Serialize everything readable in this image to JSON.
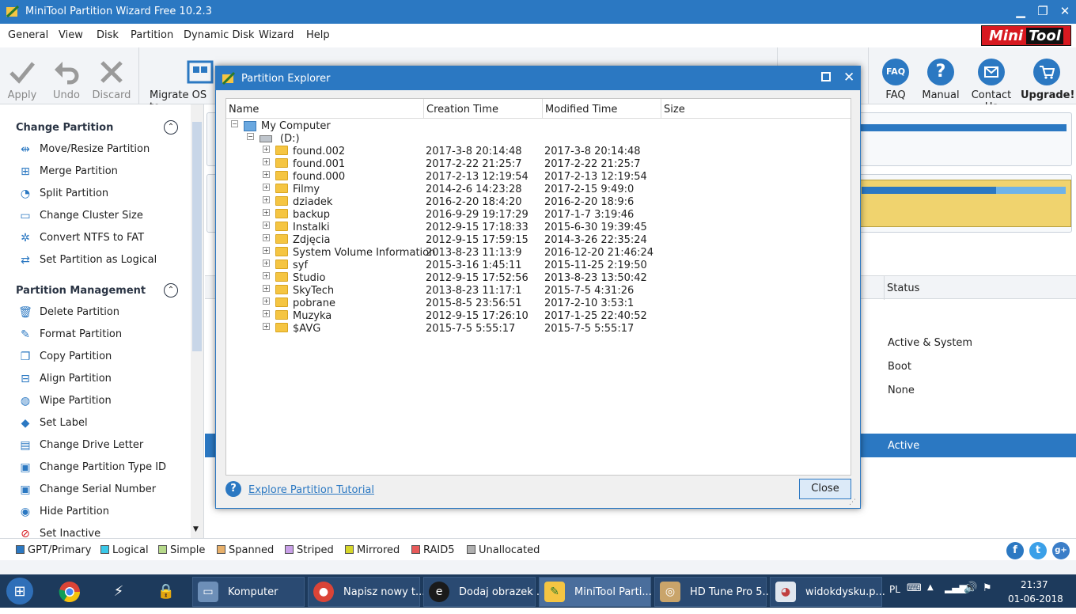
{
  "window": {
    "title": "MiniTool Partition Wizard Free 10.2.3",
    "minimize": "▁",
    "maximize": "❐",
    "close": "✕"
  },
  "menu": [
    "General",
    "View",
    "Disk",
    "Partition",
    "Dynamic Disk",
    "Wizard",
    "Help"
  ],
  "logo": {
    "mini": "Mini",
    "tool": "Tool"
  },
  "toolbar": {
    "apply": "Apply",
    "undo": "Undo",
    "discard": "Discard",
    "migrate": "Migrate OS to",
    "faq": "FAQ",
    "faq_icon_text": "FAQ",
    "manual": "Manual",
    "contact": "Contact Us",
    "upgrade": "Upgrade!"
  },
  "sidebar": {
    "change_partition": {
      "title": "Change Partition",
      "items": [
        "Move/Resize Partition",
        "Merge Partition",
        "Split Partition",
        "Change Cluster Size",
        "Convert NTFS to FAT",
        "Set Partition as Logical"
      ]
    },
    "partition_management": {
      "title": "Partition Management",
      "items": [
        "Delete Partition",
        "Format Partition",
        "Copy Partition",
        "Align Partition",
        "Wipe Partition",
        "Set Label",
        "Change Drive Letter",
        "Change Partition Type ID",
        "Change Serial Number",
        "Hide Partition",
        "Set Inactive"
      ]
    }
  },
  "main": {
    "status_header": "Status",
    "status_rows": [
      "Active & System",
      "Boot",
      "None",
      "Active"
    ],
    "colors": {
      "disk_bar": "#2b78c2",
      "selected_partition": "#f0d36e",
      "selected_row": "#2b78c2"
    }
  },
  "legend": [
    "GPT/Primary",
    "Logical",
    "Simple",
    "Spanned",
    "Striped",
    "Mirrored",
    "RAID5",
    "Unallocated"
  ],
  "legend_colors": [
    "#2b78c2",
    "#3ac8e8",
    "#b6d98a",
    "#e8b06a",
    "#c9a0e8",
    "#d6d62a",
    "#e85a5a",
    "#b0b0b0"
  ],
  "social": [
    "f",
    "t",
    "g+"
  ],
  "dialog": {
    "title": "Partition Explorer",
    "columns": [
      "Name",
      "Creation Time",
      "Modified Time",
      "Size"
    ],
    "root": "My Computer",
    "drive": "(D:)",
    "folders": [
      {
        "name": "found.002",
        "created": "2017-3-8 20:14:48",
        "modified": "2017-3-8 20:14:48"
      },
      {
        "name": "found.001",
        "created": "2017-2-22 21:25:7",
        "modified": "2017-2-22 21:25:7"
      },
      {
        "name": "found.000",
        "created": "2017-2-13 12:19:54",
        "modified": "2017-2-13 12:19:54"
      },
      {
        "name": "Filmy",
        "created": "2014-2-6 14:23:28",
        "modified": "2017-2-15 9:49:0"
      },
      {
        "name": "dziadek",
        "created": "2016-2-20 18:4:20",
        "modified": "2016-2-20 18:9:6"
      },
      {
        "name": "backup",
        "created": "2016-9-29 19:17:29",
        "modified": "2017-1-7 3:19:46"
      },
      {
        "name": "Instalki",
        "created": "2012-9-15 17:18:33",
        "modified": "2015-6-30 19:39:45"
      },
      {
        "name": "Zdjęcia",
        "created": "2012-9-15 17:59:15",
        "modified": "2014-3-26 22:35:24"
      },
      {
        "name": "System Volume Information",
        "created": "2013-8-23 11:13:9",
        "modified": "2016-12-20 21:46:24"
      },
      {
        "name": "syf",
        "created": "2015-3-16 1:45:11",
        "modified": "2015-11-25 2:19:50"
      },
      {
        "name": "Studio",
        "created": "2012-9-15 17:52:56",
        "modified": "2013-8-23 13:50:42"
      },
      {
        "name": "SkyTech",
        "created": "2013-8-23 11:17:1",
        "modified": "2015-7-5 4:31:26"
      },
      {
        "name": "pobrane",
        "created": "2015-8-5 23:56:51",
        "modified": "2017-2-10 3:53:1"
      },
      {
        "name": "Muzyka",
        "created": "2012-9-15 17:26:10",
        "modified": "2017-1-25 22:40:52"
      },
      {
        "name": "$AVG",
        "created": "2015-7-5 5:55:17",
        "modified": "2015-7-5 5:55:17"
      }
    ],
    "tutorial_link": "Explore Partition Tutorial",
    "close_button": "Close"
  },
  "taskbar": {
    "tasks": [
      "Komputer",
      "Napisz nowy t...",
      "Dodaj obrazek ...",
      "MiniTool Parti...",
      "HD Tune Pro 5...",
      "widokdysku.p..."
    ],
    "lang": "PL",
    "time": "21:37",
    "date": "01-06-2018"
  }
}
